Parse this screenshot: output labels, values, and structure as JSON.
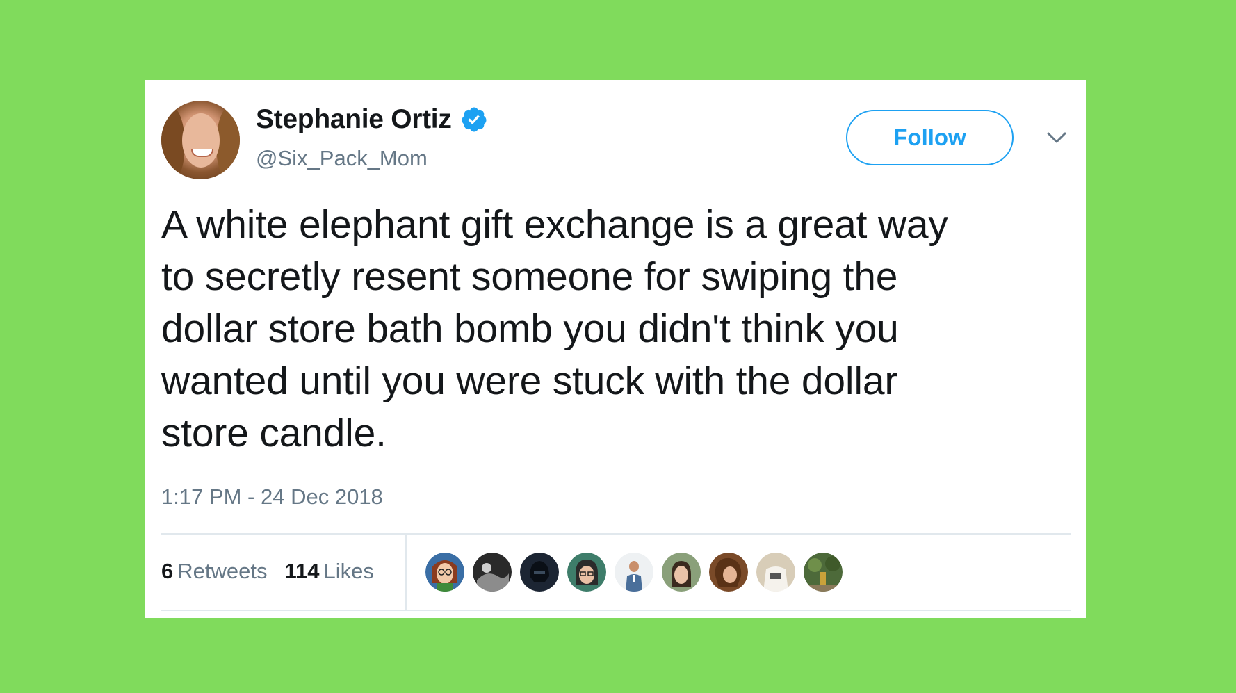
{
  "user": {
    "display_name": "Stephanie Ortiz",
    "handle": "@Six_Pack_Mom",
    "verified": true,
    "avatar_icon": "profile-photo"
  },
  "actions": {
    "follow_label": "Follow",
    "menu_icon": "chevron-down-icon"
  },
  "tweet": {
    "text": "A white elephant gift exchange is a great way\nto secretly resent someone for swiping the\ndollar store bath bomb you didn't think you\nwanted until you were stuck with the dollar\nstore candle.",
    "timestamp": "1:17 PM - 24 Dec 2018"
  },
  "stats": {
    "retweets_count": "6",
    "retweets_label": "Retweets",
    "likes_count": "114",
    "likes_label": "Likes"
  },
  "likers": [
    {
      "color": "#3a6ea5"
    },
    {
      "color": "#2a2a2a"
    },
    {
      "color": "#1c2533"
    },
    {
      "color": "#3e7d6a"
    },
    {
      "color": "#eef1f3"
    },
    {
      "color": "#8aa07a"
    },
    {
      "color": "#7a4a28"
    },
    {
      "color": "#d8cdb8"
    },
    {
      "color": "#4d6a3a"
    }
  ],
  "colors": {
    "background": "#80db5c",
    "accent": "#1da1f2",
    "secondary_text": "#657786",
    "primary_text": "#14171a"
  }
}
